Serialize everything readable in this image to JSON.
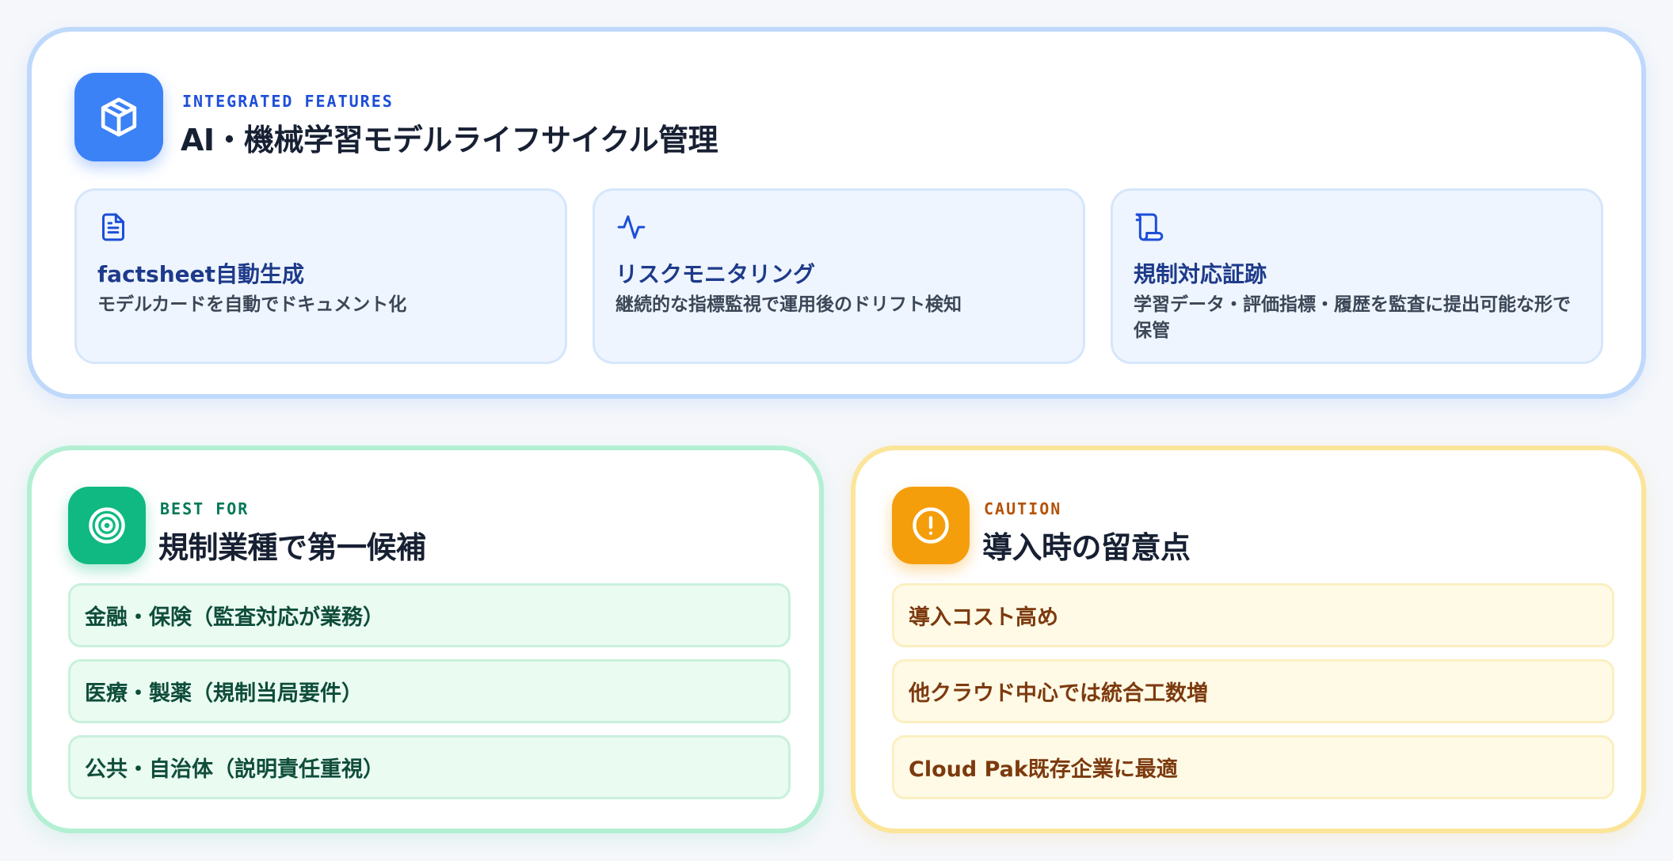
{
  "features_section": {
    "eyebrow": "INTEGRATED FEATURES",
    "title": "AI・機械学習モデルライフサイクル管理",
    "icon": "package-icon",
    "accent": "#3b82f6",
    "items": [
      {
        "icon": "document-icon",
        "title": "factsheet自動生成",
        "description": "モデルカードを自動でドキュメント化"
      },
      {
        "icon": "activity-icon",
        "title": "リスクモニタリング",
        "description": "継続的な指標監視で運用後のドリフト検知"
      },
      {
        "icon": "scroll-icon",
        "title": "規制対応証跡",
        "description": "学習データ・評価指標・履歴を監査に提出可能な形で保管"
      }
    ]
  },
  "best_for": {
    "eyebrow": "BEST FOR",
    "title": "規制業種で第一候補",
    "icon": "target-icon",
    "accent": "#10b981",
    "items": [
      "金融・保険（監査対応が業務）",
      "医療・製薬（規制当局要件）",
      "公共・自治体（説明責任重視）"
    ]
  },
  "caution": {
    "eyebrow": "CAUTION",
    "title": "導入時の留意点",
    "icon": "alert-circle-icon",
    "accent": "#f59e0b",
    "items": [
      "導入コスト高め",
      "他クラウド中心では統合工数増",
      "Cloud Pak既存企業に最適"
    ]
  }
}
